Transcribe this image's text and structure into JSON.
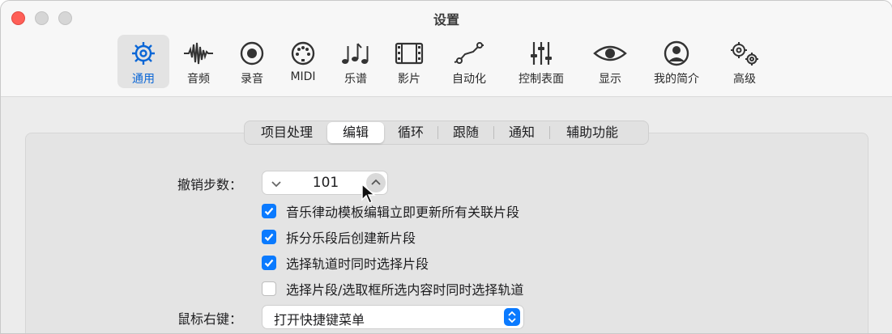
{
  "window": {
    "title": "设置"
  },
  "toolbar": {
    "tabs": [
      {
        "label": "通用",
        "icon": "gear-icon",
        "active": true
      },
      {
        "label": "音频",
        "icon": "waveform-icon"
      },
      {
        "label": "录音",
        "icon": "record-icon"
      },
      {
        "label": "MIDI",
        "icon": "midi-connector-icon"
      },
      {
        "label": "乐谱",
        "icon": "music-notes-icon"
      },
      {
        "label": "影片",
        "icon": "film-icon"
      },
      {
        "label": "自动化",
        "icon": "automation-curve-icon"
      },
      {
        "label": "控制表面",
        "icon": "sliders-icon"
      },
      {
        "label": "显示",
        "icon": "eye-icon"
      },
      {
        "label": "我的简介",
        "icon": "person-icon"
      },
      {
        "label": "高级",
        "icon": "gears-icon"
      }
    ]
  },
  "segments": {
    "items": [
      "项目处理",
      "编辑",
      "循环",
      "跟随",
      "通知",
      "辅助功能"
    ],
    "selected": "编辑"
  },
  "undo": {
    "label": "撤销步数：",
    "value": "101"
  },
  "checkboxes": [
    {
      "label": "音乐律动模板编辑立即更新所有关联片段",
      "checked": true
    },
    {
      "label": "拆分乐段后创建新片段",
      "checked": true
    },
    {
      "label": "选择轨道时同时选择片段",
      "checked": true
    },
    {
      "label": "选择片段/选取框所选内容时同时选择轨道",
      "checked": false
    }
  ],
  "right_click": {
    "label": "鼠标右键：",
    "value": "打开快捷键菜单"
  },
  "colors": {
    "accent": "#0a7aff",
    "active_tab_text": "#0a66d6",
    "close": "#ff5f57"
  }
}
